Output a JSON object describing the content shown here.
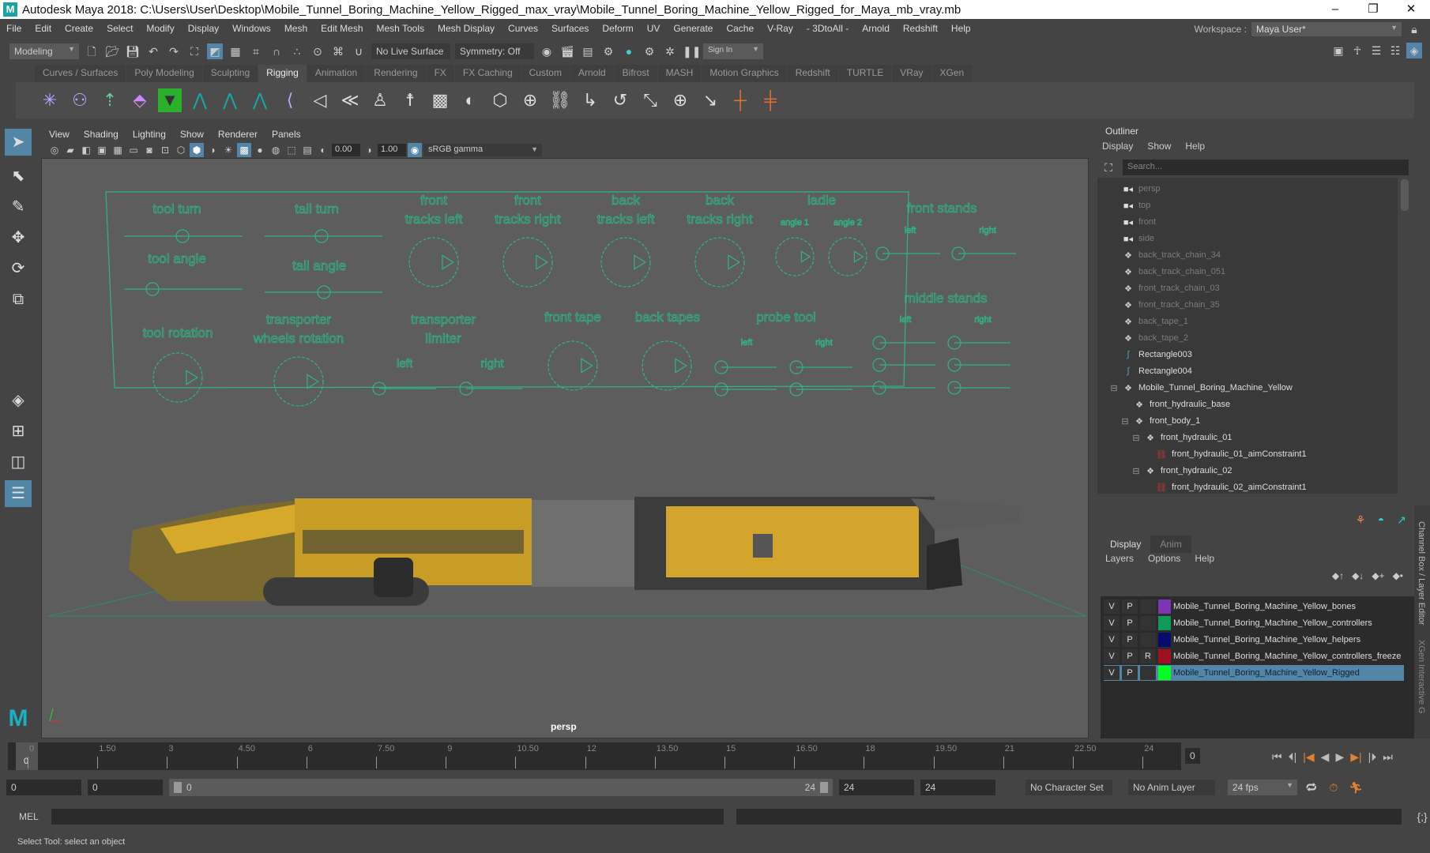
{
  "title": "Autodesk Maya 2018: C:\\Users\\User\\Desktop\\Mobile_Tunnel_Boring_Machine_Yellow_Rigged_max_vray\\Mobile_Tunnel_Boring_Machine_Yellow_Rigged_for_Maya_mb_vray.mb",
  "menus": [
    "File",
    "Edit",
    "Create",
    "Select",
    "Modify",
    "Display",
    "Windows",
    "Mesh",
    "Edit Mesh",
    "Mesh Tools",
    "Mesh Display",
    "Curves",
    "Surfaces",
    "Deform",
    "UV",
    "Generate",
    "Cache",
    "V-Ray",
    "- 3DtoAll -",
    "Arnold",
    "Redshift",
    "Help"
  ],
  "workspace": {
    "label": "Workspace :",
    "value": "Maya User*"
  },
  "statusline": {
    "mode": "Modeling",
    "live_surface": "No Live Surface",
    "symmetry": "Symmetry: Off",
    "sign_in": "Sign In"
  },
  "shelf_tabs": [
    "Curves / Surfaces",
    "Poly Modeling",
    "Sculpting",
    "Rigging",
    "Animation",
    "Rendering",
    "FX",
    "FX Caching",
    "Custom",
    "Arnold",
    "Bifrost",
    "MASH",
    "Motion Graphics",
    "Redshift",
    "TURTLE",
    "VRay",
    "XGen"
  ],
  "active_shelf": "Rigging",
  "viewport": {
    "menus": [
      "View",
      "Shading",
      "Lighting",
      "Show",
      "Renderer",
      "Panels"
    ],
    "exposure": "0.00",
    "gamma": "1.00",
    "color_space": "sRGB gamma",
    "camera": "persp",
    "controls": {
      "tool_turn": "tool turn",
      "tail_turn": "tail turn",
      "tool_angle": "tool angle",
      "tail_angle": "tail angle",
      "front_tracks_left": [
        "front",
        "tracks left"
      ],
      "front_tracks_right": [
        "front",
        "tracks right"
      ],
      "back_tracks_left": [
        "back",
        "tracks left"
      ],
      "back_tracks_right": [
        "back",
        "tracks right"
      ],
      "ladle": "ladle",
      "angle1": "angle 1",
      "angle2": "angle 2",
      "front_stands": "front stands",
      "middle_stands": "middle stands",
      "left": "left",
      "right": "right",
      "tool_rotation": "tool rotation",
      "transporter_wheels": [
        "transporter",
        "wheels rotation"
      ],
      "transporter_limiter": [
        "transporter",
        "limiter"
      ],
      "front_tape": "front tape",
      "back_tapes": "back tapes",
      "probe_tool": "probe tool"
    }
  },
  "outliner": {
    "title": "Outliner",
    "menus": [
      "Display",
      "Show",
      "Help"
    ],
    "search_placeholder": "Search...",
    "items": [
      {
        "label": "persp",
        "icon": "camera",
        "depth": 0,
        "dim": true
      },
      {
        "label": "top",
        "icon": "camera",
        "depth": 0,
        "dim": true
      },
      {
        "label": "front",
        "icon": "camera",
        "depth": 0,
        "dim": true
      },
      {
        "label": "side",
        "icon": "camera",
        "depth": 0,
        "dim": true
      },
      {
        "label": "back_track_chain_34",
        "icon": "group",
        "depth": 0,
        "dim": true
      },
      {
        "label": "back_track_chain_051",
        "icon": "group",
        "depth": 0,
        "dim": true
      },
      {
        "label": "front_track_chain_03",
        "icon": "group",
        "depth": 0,
        "dim": true
      },
      {
        "label": "front_track_chain_35",
        "icon": "group",
        "depth": 0,
        "dim": true
      },
      {
        "label": "back_tape_1",
        "icon": "group",
        "depth": 0,
        "dim": true
      },
      {
        "label": "back_tape_2",
        "icon": "group",
        "depth": 0,
        "dim": true
      },
      {
        "label": "Rectangle003",
        "icon": "curve",
        "depth": 0,
        "dim": false
      },
      {
        "label": "Rectangle004",
        "icon": "curve",
        "depth": 0,
        "dim": false
      },
      {
        "label": "Mobile_Tunnel_Boring_Machine_Yellow",
        "icon": "group",
        "depth": 0,
        "dim": false,
        "expanded": true
      },
      {
        "label": "front_hydraulic_base",
        "icon": "group",
        "depth": 1,
        "dim": false
      },
      {
        "label": "front_body_1",
        "icon": "group",
        "depth": 1,
        "dim": false,
        "expanded": true
      },
      {
        "label": "front_hydraulic_01",
        "icon": "group",
        "depth": 2,
        "dim": false,
        "expanded": true
      },
      {
        "label": "front_hydraulic_01_aimConstraint1",
        "icon": "constraint",
        "depth": 3,
        "dim": false
      },
      {
        "label": "front_hydraulic_02",
        "icon": "group",
        "depth": 2,
        "dim": false,
        "expanded": true
      },
      {
        "label": "front_hydraulic_02_aimConstraint1",
        "icon": "constraint",
        "depth": 3,
        "dim": false
      }
    ]
  },
  "layer_editor": {
    "tabs": [
      "Display",
      "Anim"
    ],
    "menus": [
      "Layers",
      "Options",
      "Help"
    ],
    "layers": [
      {
        "v": "V",
        "p": "P",
        "r": "",
        "name": "Mobile_Tunnel_Boring_Machine_Yellow_bones",
        "color": "#7b35b5",
        "selected": false
      },
      {
        "v": "V",
        "p": "P",
        "r": "",
        "name": "Mobile_Tunnel_Boring_Machine_Yellow_controllers",
        "color": "#0f9a5a",
        "selected": false
      },
      {
        "v": "V",
        "p": "P",
        "r": "",
        "name": "Mobile_Tunnel_Boring_Machine_Yellow_helpers",
        "color": "#0a0a6e",
        "selected": false
      },
      {
        "v": "V",
        "p": "P",
        "r": "R",
        "name": "Mobile_Tunnel_Boring_Machine_Yellow_controllers_freeze",
        "color": "#a01025",
        "selected": false
      },
      {
        "v": "V",
        "p": "P",
        "r": "",
        "name": "Mobile_Tunnel_Boring_Machine_Yellow_Rigged",
        "color": "#00ff22",
        "selected": true
      }
    ]
  },
  "side_tabs": [
    "Channel Box / Layer Editor",
    "XGen Interactive G"
  ],
  "timeline": {
    "ticks": [
      "0",
      "1.50",
      "3",
      "4.50",
      "6",
      "7.50",
      "9",
      "10.50",
      "12",
      "13.50",
      "15",
      "16.50",
      "18",
      "19.50",
      "21",
      "22.50",
      "24"
    ],
    "current": "0",
    "current_field": "0"
  },
  "range": {
    "start": "0",
    "anim_start": "0",
    "slider_start": "0",
    "slider_end": "24",
    "anim_end": "24",
    "end": "24",
    "character_set": "No Character Set",
    "anim_layer": "No Anim Layer",
    "fps": "24 fps"
  },
  "mel": {
    "label": "MEL"
  },
  "status": "Select Tool: select an object",
  "colors": {
    "accent": "#5285a6",
    "rig": "#2fb582",
    "viewport": "#5d5d5d"
  }
}
